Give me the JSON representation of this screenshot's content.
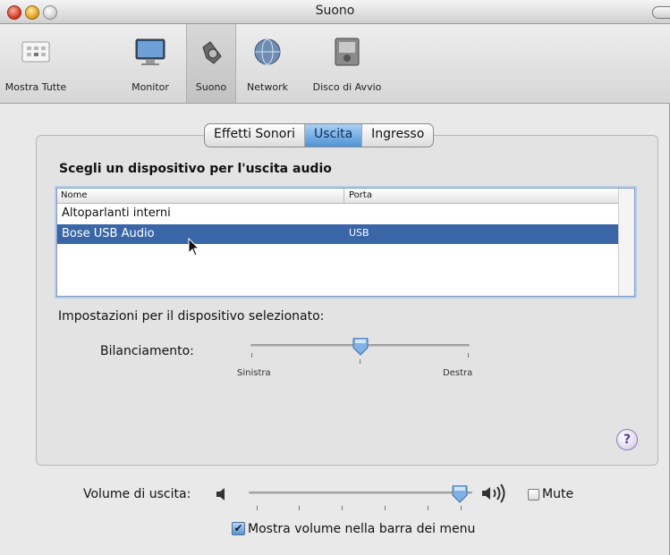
{
  "window": {
    "title": "Suono"
  },
  "toolbar": {
    "items": [
      {
        "label": "Mostra Tutte",
        "icon": "grid-icon"
      },
      {
        "label": "Monitor",
        "icon": "monitor-icon"
      },
      {
        "label": "Suono",
        "icon": "speaker-icon",
        "selected": true
      },
      {
        "label": "Network",
        "icon": "network-globe-icon"
      },
      {
        "label": "Disco di Avvio",
        "icon": "disk-icon"
      }
    ]
  },
  "tabs": [
    {
      "label": "Effetti Sonori",
      "selected": false
    },
    {
      "label": "Uscita",
      "selected": true
    },
    {
      "label": "Ingresso",
      "selected": false
    }
  ],
  "output": {
    "section_title": "Scegli un dispositivo per l'uscita audio",
    "columns": [
      "Nome",
      "Porta"
    ],
    "rows": [
      {
        "name": "Altoparlanti interni",
        "port": "",
        "selected": false
      },
      {
        "name": "Bose USB Audio",
        "port": "USB",
        "selected": true
      }
    ],
    "settings_label": "Impostazioni per il dispositivo selezionato:",
    "balance": {
      "label": "Bilanciamento:",
      "left": "Sinistra",
      "right": "Destra",
      "value": 0.5
    }
  },
  "footer": {
    "volume_label": "Volume di uscita:",
    "volume_value": 0.92,
    "mute_label": "Mute",
    "mute_checked": false,
    "show_volume_label": "Mostra volume nella barra dei menu",
    "show_volume_checked": true
  },
  "help": {
    "label": "?"
  },
  "colors": {
    "selection": "#3a66a8",
    "tab_selected": "#6aa8e3"
  }
}
